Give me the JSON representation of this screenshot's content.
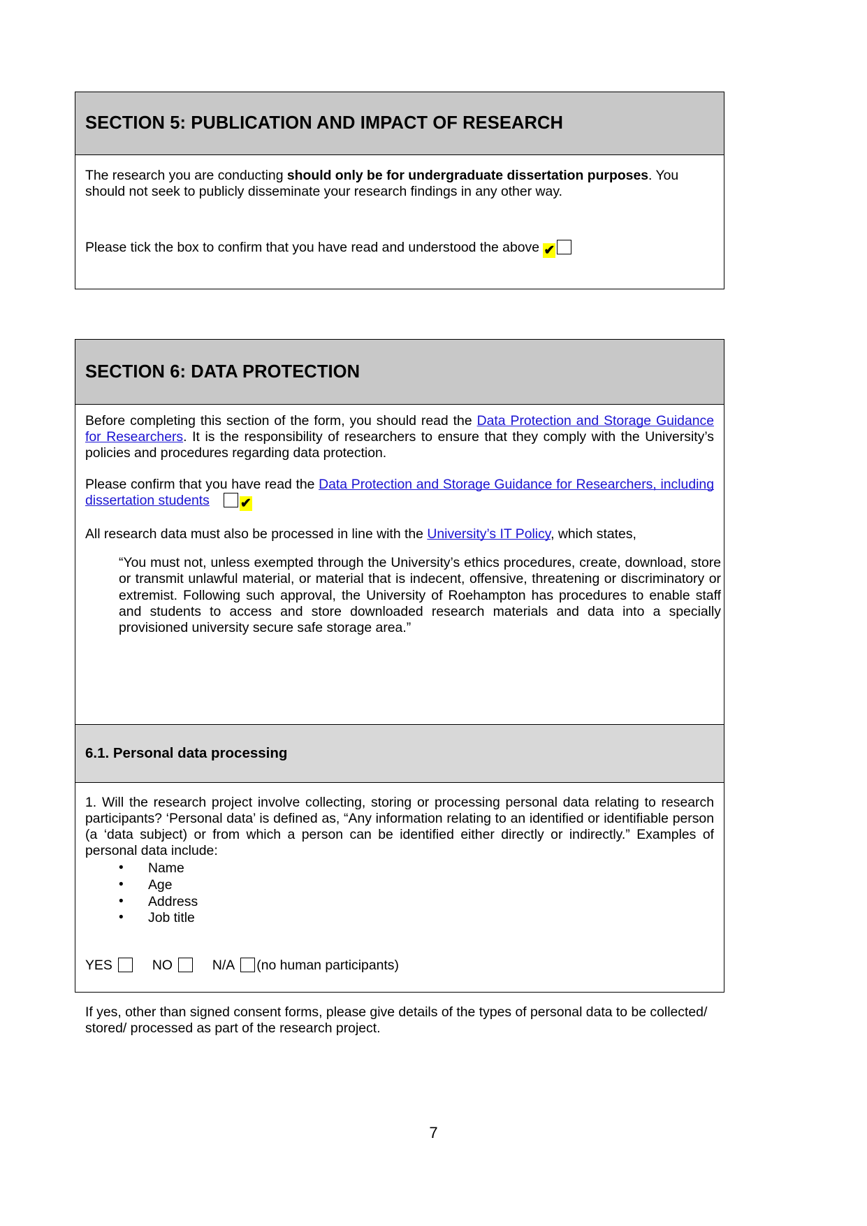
{
  "document": {
    "page_number": "7",
    "colors": {
      "section_header_bg": "#c8c8c8",
      "subsection_header_bg": "#d8d8d8",
      "link": "#1a13d2",
      "highlight": "#ffff00",
      "border": "#000000"
    }
  },
  "section5": {
    "heading": "SECTION 5: PUBLICATION  AND IMPACT OF RESEARCH",
    "paragraph": {
      "before_bold": "The research you are conducting ",
      "bold": "should only be for undergraduate dissertation purposes",
      "after_bold": ". You should not seek to publicly disseminate your research findings in any other way."
    },
    "confirm_line": "Please tick the box to confirm that you have read and understood the above",
    "tick_mark": "✔"
  },
  "section6": {
    "heading": "SECTION 6: DATA PROTECTION",
    "intro": {
      "lead": "Before completing this section of the form, you should read the ",
      "link": "Data Protection and Storage Guidance for Researchers",
      "tail": ". It is the responsibility of researchers to ensure that they comply with the University’s policies and procedures regarding data protection."
    },
    "confirm": {
      "lead": "Please confirm that you have read the ",
      "link": "Data Protection and Storage Guidance for Researchers, including dissertation students",
      "tick_mark": "✔"
    },
    "it_policy": {
      "lead": "All research data must also be processed in line with the ",
      "link": "University’s IT Policy",
      "tail": ", which states,"
    },
    "quote": "“You must not, unless exempted through the University’s ethics procedures, create, download, store or transmit unlawful material, or material that is indecent, offensive, threatening or discriminatory or extremist. Following such approval, the University of Roehampton has procedures to enable staff and students to access and store downloaded research materials and data into a specially provisioned university secure safe storage area.”"
  },
  "subsection61": {
    "heading": "6.1. Personal data processing",
    "question1": "1. Will the research project involve collecting, storing or processing personal data relating to research participants? ‘Personal data’ is defined as, “Any information relating to an identified or identifiable person (a ‘data subject) or from which a person can be identified either directly or indirectly.” Examples of personal data include:",
    "examples": [
      "Name",
      "Age",
      "Address",
      "Job title"
    ],
    "answer_options": [
      {
        "label": "YES",
        "checked": false
      },
      {
        "label": "NO",
        "checked": false
      },
      {
        "label": "N/A",
        "checked": false
      }
    ],
    "na_note": "(no human participants)",
    "followup": "If yes, other than signed consent forms, please give details of the types of personal data to be collected/ stored/ processed as part of the research project."
  }
}
